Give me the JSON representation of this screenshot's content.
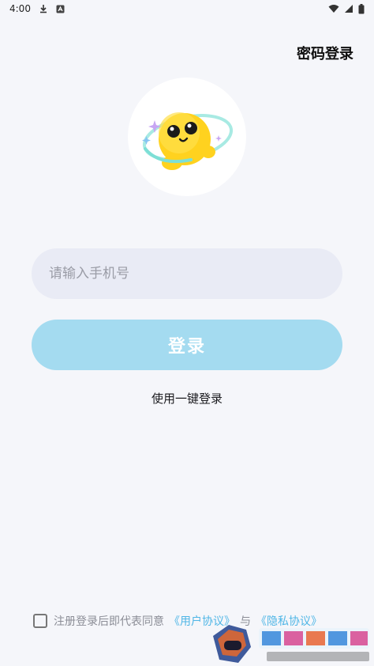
{
  "status_bar": {
    "time": "4:00"
  },
  "header": {
    "password_login_label": "密码登录"
  },
  "form": {
    "phone_placeholder": "请输入手机号",
    "login_label": "登录",
    "onekey_label": "使用一键登录"
  },
  "agreement": {
    "prefix": "注册登录后即代表同意",
    "user_agreement": "《用户协议》",
    "and": "与",
    "privacy_agreement": "《隐私协议》"
  },
  "colors": {
    "background": "#f5f6fa",
    "input_bg": "#e9ebf5",
    "button_bg": "#a4dbf0",
    "link": "#4fb6e6",
    "mascot_yellow": "#ffd21f"
  },
  "icons": [
    "download-icon",
    "a-icon",
    "wifi-icon",
    "signal-icon",
    "battery-icon",
    "mascot-logo",
    "checkbox-icon"
  ]
}
